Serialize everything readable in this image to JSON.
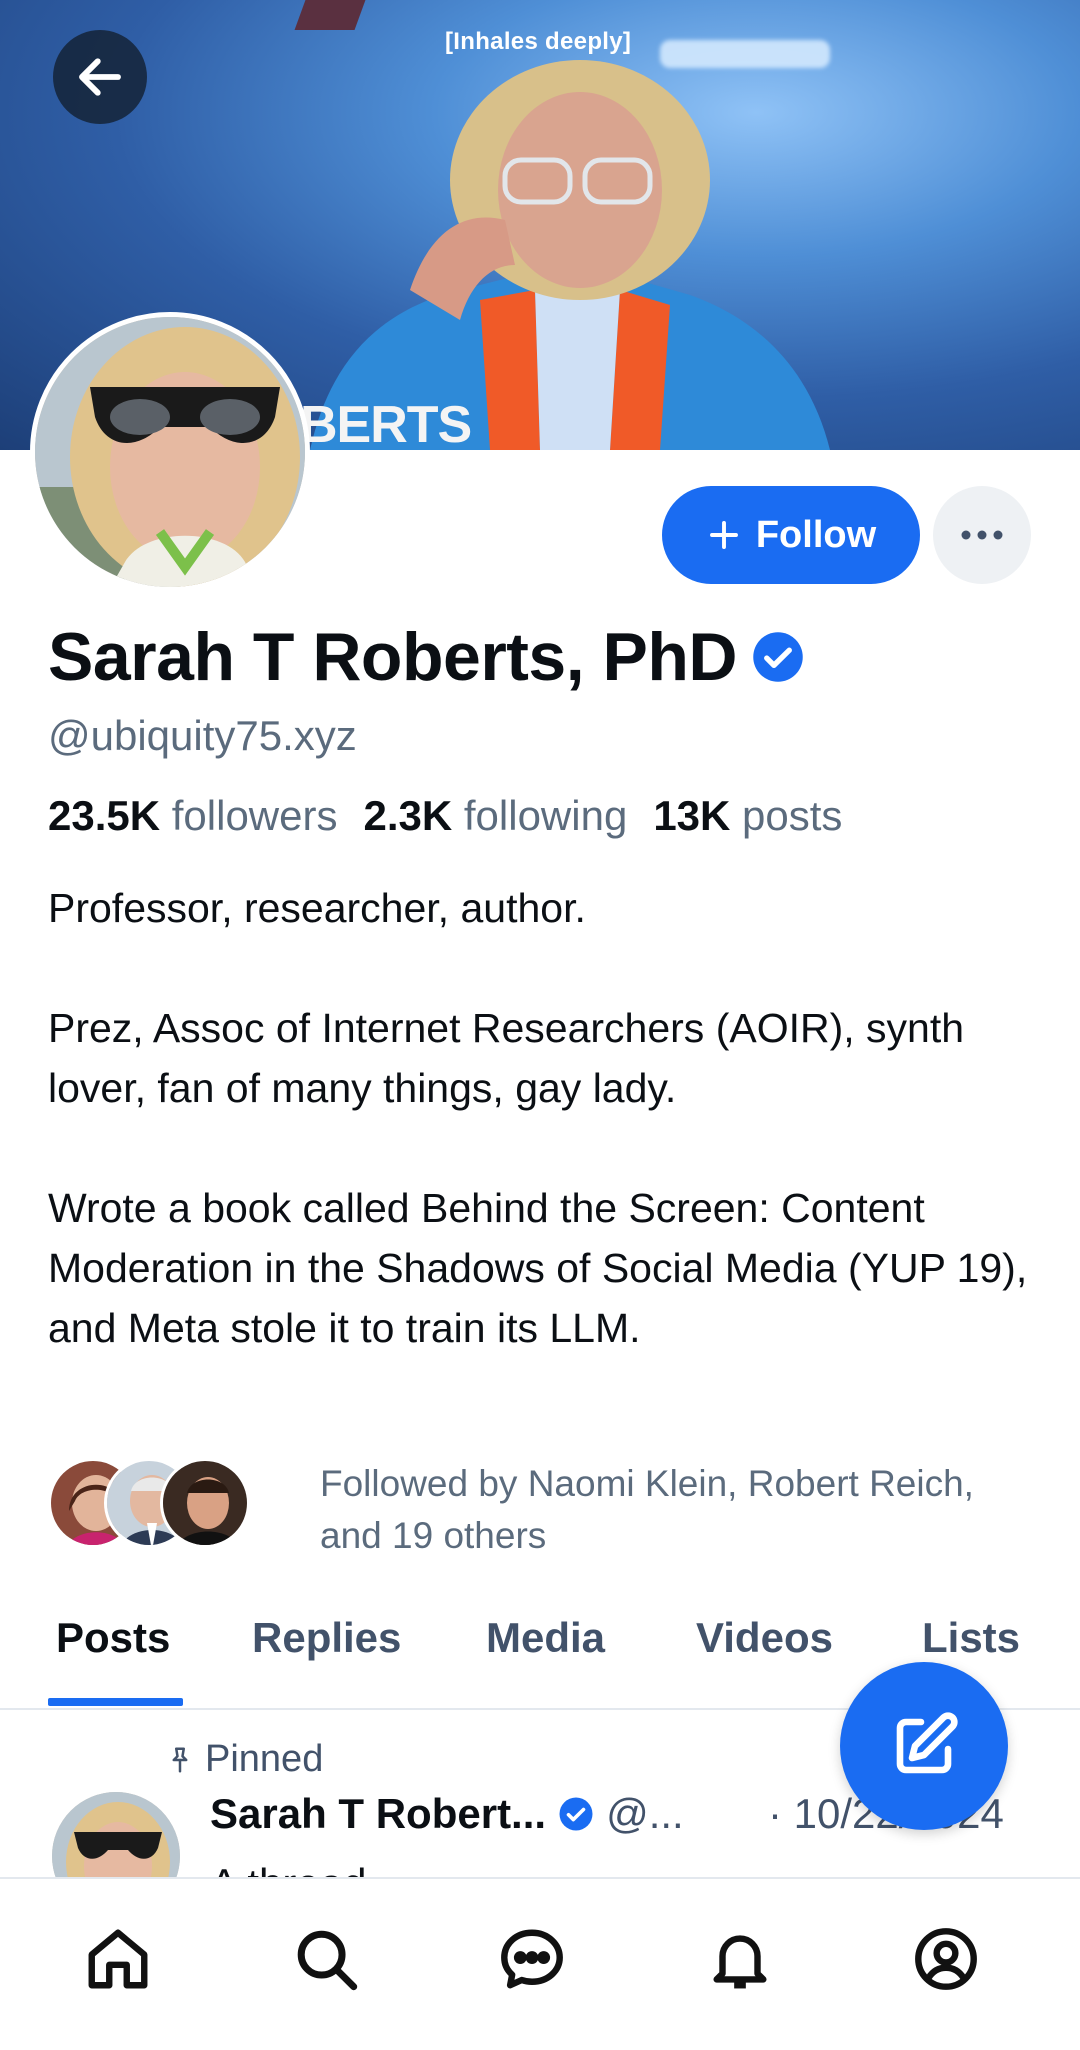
{
  "banner": {
    "caption": "[Inhales deeply]",
    "wall_text": "BERTS"
  },
  "actions": {
    "follow_label": "Follow",
    "more_icon": "ellipsis-icon"
  },
  "profile": {
    "name": "Sarah T Roberts, PhD",
    "verified": true,
    "handle": "@ubiquity75.xyz",
    "stats": {
      "followers_value": "23.5K",
      "followers_label": "followers",
      "following_value": "2.3K",
      "following_label": "following",
      "posts_value": "13K",
      "posts_label": "posts"
    },
    "bio": [
      "Professor, researcher, author.",
      "Prez, Assoc of Internet Researchers (AOIR), synth lover, fan of many things, gay lady.",
      "Wrote a book called Behind the Screen: Content Moderation in the Shadows of Social Media (YUP 19), and Meta stole it to train its LLM."
    ],
    "followed_by": "Followed by Naomi Klein, Robert Reich, and 19 others"
  },
  "tabs": [
    {
      "label": "Posts",
      "active": true
    },
    {
      "label": "Replies",
      "active": false
    },
    {
      "label": "Media",
      "active": false
    },
    {
      "label": "Videos",
      "active": false
    },
    {
      "label": "Lists",
      "active": false
    }
  ],
  "pinned_post": {
    "pinned_label": "Pinned",
    "author": "Sarah T Robert...",
    "handle": "@...",
    "date": "· 10/22/2024",
    "text": "A thread"
  },
  "colors": {
    "accent": "#1a6cf2",
    "muted_text": "#5b6b7d"
  },
  "bottom_nav": [
    "home-icon",
    "search-icon",
    "chat-icon",
    "bell-icon",
    "profile-icon"
  ]
}
